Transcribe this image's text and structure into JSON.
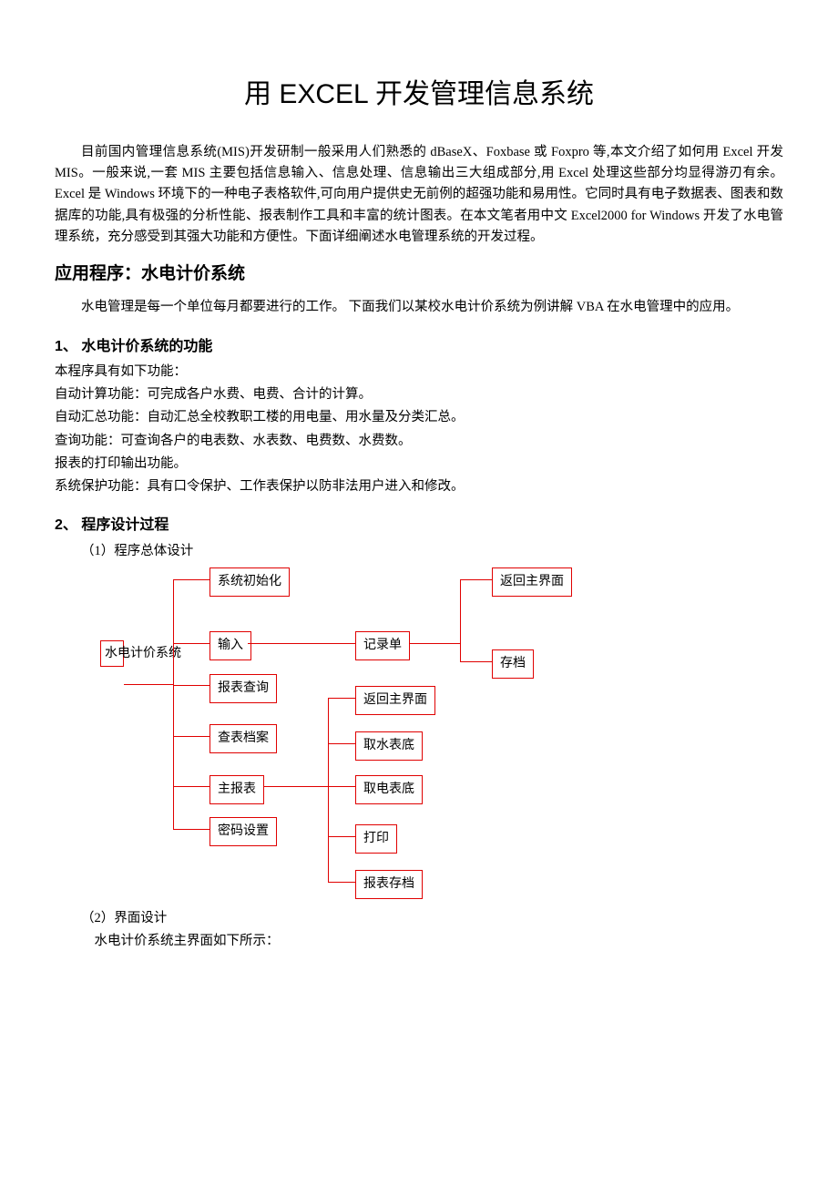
{
  "title": "用 EXCEL 开发管理信息系统",
  "intro": "目前国内管理信息系统(MIS)开发研制一般采用人们熟悉的 dBaseX、Foxbase 或 Foxpro 等,本文介绍了如何用 Excel 开发 MIS。一般来说,一套 MIS 主要包括信息输入、信息处理、信息输出三大组成部分,用 Excel 处理这些部分均显得游刃有余。Excel 是 Windows 环境下的一种电子表格软件,可向用户提供史无前例的超强功能和易用性。它同时具有电子数据表、图表和数据库的功能,具有极强的分析性能、报表制作工具和丰富的统计图表。在本文笔者用中文 Excel2000 for Windows 开发了水电管理系统，充分感受到其强大功能和方便性。下面详细阐述水电管理系统的开发过程。",
  "app_heading": "应用程序：水电计价系统",
  "app_intro": "水电管理是每一个单位每月都要进行的工作。 下面我们以某校水电计价系统为例讲解 VBA 在水电管理中的应用。",
  "s1h": "1、 水电计价系统的功能",
  "s1l0": "本程序具有如下功能：",
  "s1l1": "自动计算功能：可完成各户水费、电费、合计的计算。",
  "s1l2": "自动汇总功能：自动汇总全校教职工楼的用电量、用水量及分类汇总。",
  "s1l3": "查询功能：可查询各户的电表数、水表数、电费数、水费数。",
  "s1l4": "报表的打印输出功能。",
  "s1l5": "系统保护功能：具有口令保护、工作表保护以防非法用户进入和修改。",
  "s2h": "2、 程序设计过程",
  "s2l1": "（1）程序总体设计",
  "s2l2": "（2）界面设计",
  "s2l3": "水电计价系统主界面如下所示：",
  "diagram": {
    "root": "水电计价系统",
    "c1_1": "系统初始化",
    "c1_2": "输入",
    "c1_3": "报表查询",
    "c1_4": "查表档案",
    "c1_5": "主报表",
    "c1_6": "密码设置",
    "c2_1": "记录单",
    "c2_2": "返回主界面",
    "c2_3": "取水表底",
    "c2_4": "取电表底",
    "c2_5": "打印",
    "c2_6": "报表存档",
    "c3_1": "返回主界面",
    "c3_2": "存档"
  }
}
